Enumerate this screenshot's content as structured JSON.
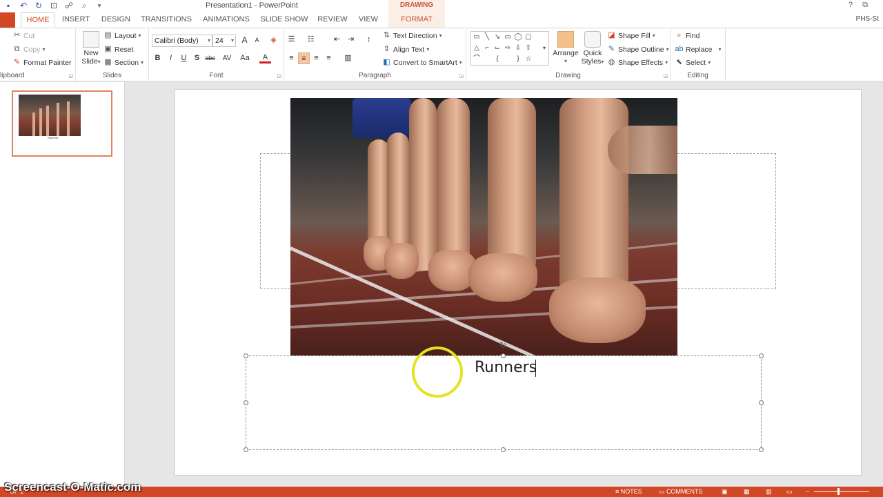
{
  "title_bar": {
    "doc_title": "Presentation1 - PowerPoint",
    "contextual": "DRAWING TOOLS",
    "help": "?",
    "restore": "⧉"
  },
  "tabs": [
    "HOME",
    "INSERT",
    "DESIGN",
    "TRANSITIONS",
    "ANIMATIONS",
    "SLIDE SHOW",
    "REVIEW",
    "VIEW",
    "FORMAT"
  ],
  "account": "PHS-St",
  "clipboard": {
    "cut": "Cut",
    "copy": "Copy",
    "format_painter": "Format Painter",
    "label": "lipboard"
  },
  "slides": {
    "new_slide": "New",
    "new_slide2": "Slide",
    "layout": "Layout",
    "reset": "Reset",
    "section": "Section",
    "label": "Slides"
  },
  "font": {
    "family": "Calibri (Body)",
    "size": "24",
    "label": "Font",
    "bold": "B",
    "italic": "I",
    "underline": "U",
    "shadow": "S",
    "strike": "abc",
    "spacing": "AV",
    "case": "Aa",
    "color": "A",
    "grow": "A",
    "shrink": "A"
  },
  "paragraph": {
    "text_direction": "Text Direction",
    "align_text": "Align Text",
    "smartart": "Convert to SmartArt",
    "label": "Paragraph"
  },
  "drawing": {
    "arrange": "Arrange",
    "quick": "Quick",
    "styles": "Styles",
    "shape_fill": "Shape Fill",
    "shape_outline": "Shape Outline",
    "shape_effects": "Shape Effects",
    "label": "Drawing"
  },
  "editing": {
    "find": "Find",
    "replace": "Replace",
    "select": "Select",
    "label": "Editing"
  },
  "thumbnail": {
    "caption": "Runners"
  },
  "slide": {
    "text": "Runners"
  },
  "statusbar": {
    "slide": "OF 1",
    "notes": "NOTES",
    "comments": "COMMENTS"
  },
  "watermark": "Screencast-O-Matic.com",
  "colors": {
    "accent": "#d24726",
    "format_tab_bg": "#fbeee4",
    "highlight": "#e4e321"
  }
}
